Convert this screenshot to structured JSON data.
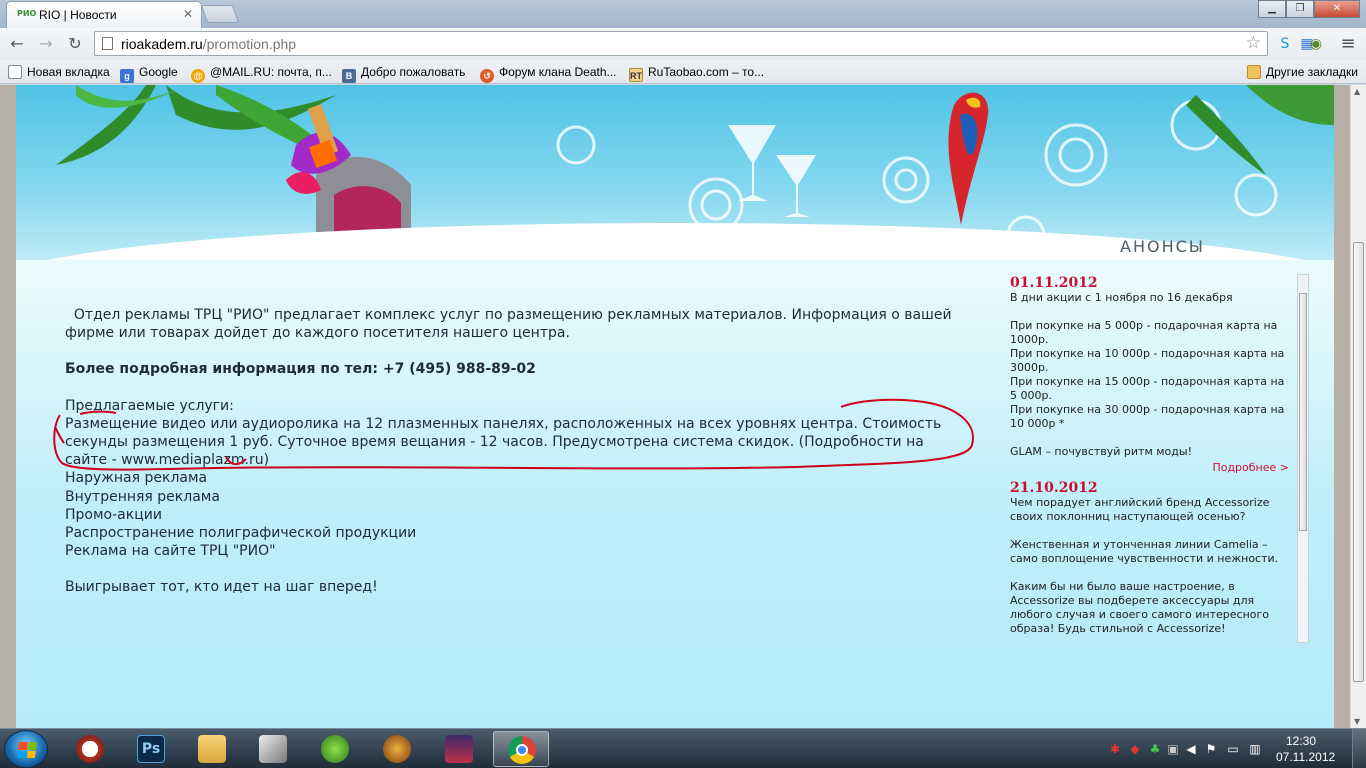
{
  "browser": {
    "tab_title": "RIO | Новости",
    "tab_favicon_text": "РИО",
    "url_host": "rioakadem.ru",
    "url_path": "/promotion.php",
    "bookmarks": [
      {
        "label": "Новая вкладка",
        "icon": "page-icon"
      },
      {
        "label": "Google",
        "icon": "google-icon"
      },
      {
        "label": "@MAIL.RU: почта, п...",
        "icon": "mailru-icon"
      },
      {
        "label": "Добро пожаловать",
        "icon": "vk-icon"
      },
      {
        "label": "Форум клана Death...",
        "icon": "forum-icon"
      },
      {
        "label": "RuTaobao.com – то...",
        "icon": "rt-icon"
      }
    ],
    "other_bookmarks": "Другие закладки"
  },
  "page": {
    "intro": "Отдел рекламы ТРЦ \"РИО\" предлагает комплекс услуг по размещению рекламных материалов. Информация о вашей фирме или товарах дойдет до каждого посетителя нашего центра.",
    "contact": "Более подробная информация по тел: +7 (495) 988-89-02",
    "services_heading": "Предлагаемые услуги:",
    "services": [
      "Размещение видео или аудиоролика на 12 плазменных панелях, расположенных на всех уровнях центра. Стоимость секунды размещения 1 руб. Суточное время вещания - 12 часов. Предусмотрена система скидок. (Подробности на сайте - www.mediaplazm.ru)",
      "Наружная реклама",
      "Внутренняя реклама",
      "Промо-акции",
      "Распространение полиграфической продукции",
      "Реклама на сайте ТРЦ \"РИО\""
    ],
    "slogan": "Выигрывает тот, кто идет на шаг вперед!"
  },
  "sidebar": {
    "title": "АНОНСЫ",
    "news": [
      {
        "date": "01.11.2012",
        "lines": [
          "В дни акции с 1 ноября по 16 декабря",
          "",
          "При покупке  на 5 000р   - подарочная карта на 1000р.",
          "При покупке  на 10 000р - подарочная карта на 3000р.",
          "При покупке  на 15 000р - подарочная карта на 5 000р.",
          "При покупке  на 30 000р - подарочная карта на 10 000р *",
          "",
          "GLAM – почувствуй ритм моды!"
        ],
        "more": "Подробнее >"
      },
      {
        "date": "21.10.2012",
        "lines": [
          "Чем порадует английский бренд Accessorize своих поклонниц наступающей осенью?",
          "",
          "Женственная и утонченная линии Camelia – само воплощение чувственности  и нежности.",
          "",
          "Каким бы ни было ваше настроение, в Accessorize вы подберете аксессуары для любого случая и своего самого интересного образа!  Будь стильной с Accessorize!"
        ]
      }
    ]
  },
  "taskbar": {
    "time": "12:30",
    "date": "07.11.2012",
    "apps": [
      "clock-app-icon",
      "photoshop-icon",
      "explorer-icon",
      "scanner-icon",
      "spore-icon",
      "game-icon",
      "game2-icon",
      "chrome-icon"
    ],
    "photoshop_label": "Ps"
  },
  "colors": {
    "accent_red": "#c8102e",
    "page_bg": "#bfeef9",
    "text": "#1f2b38"
  }
}
